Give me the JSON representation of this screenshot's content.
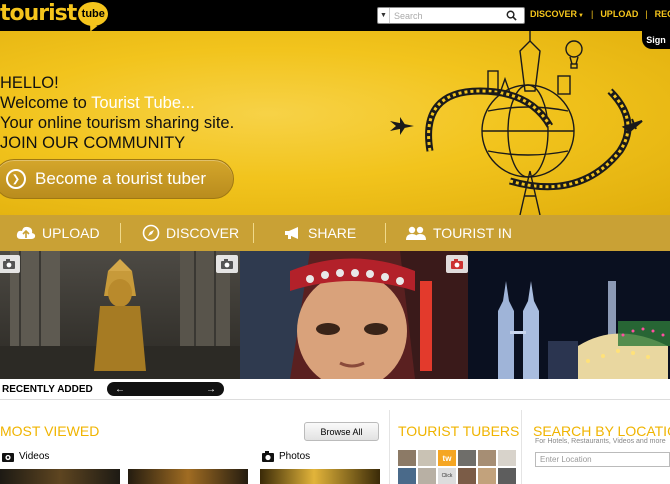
{
  "header": {
    "logo_text": "tourist",
    "logo_bubble": "tube",
    "search": {
      "placeholder": "Search"
    },
    "nav": {
      "discover": "DISCOVER",
      "upload": "UPLOAD",
      "register": "REGIST"
    },
    "signin": "Sign"
  },
  "hero": {
    "line1": "HELLO!",
    "line2_prefix": "Welcome to ",
    "line2_brand": "Tourist Tube...",
    "line3": "Your online tourism sharing site.",
    "line4": "JOIN OUR COMMUNITY",
    "cta": "Become a tourist tuber"
  },
  "actions": [
    {
      "label": "UPLOAD",
      "icon": "cloud-upload-icon"
    },
    {
      "label": "DISCOVER",
      "icon": "compass-icon"
    },
    {
      "label": "SHARE",
      "icon": "megaphone-icon"
    },
    {
      "label": "TOURIST IN",
      "icon": "people-icon"
    }
  ],
  "recent": {
    "label": "RECENTLY ADDED",
    "prev": "←",
    "next": "→"
  },
  "most_viewed": {
    "title": "MOST VIEWED",
    "browse_all": "Browse All",
    "videos_label": "Videos",
    "photos_label": "Photos"
  },
  "tubers": {
    "title": "TOURIST TUBERS",
    "tiles": [
      "",
      "",
      "tw",
      "",
      "",
      "",
      "",
      "",
      "Click",
      "",
      "",
      ""
    ]
  },
  "location": {
    "title": "SEARCH BY LOCATION",
    "subtitle": "For Hotels, Restaurants, Videos and more",
    "placeholder": "Enter Location"
  },
  "colors": {
    "brand_yellow": "#f5c51c",
    "accent_orange": "#f0b400",
    "action_bar": "#c9a135",
    "top_bar": "#000000"
  }
}
